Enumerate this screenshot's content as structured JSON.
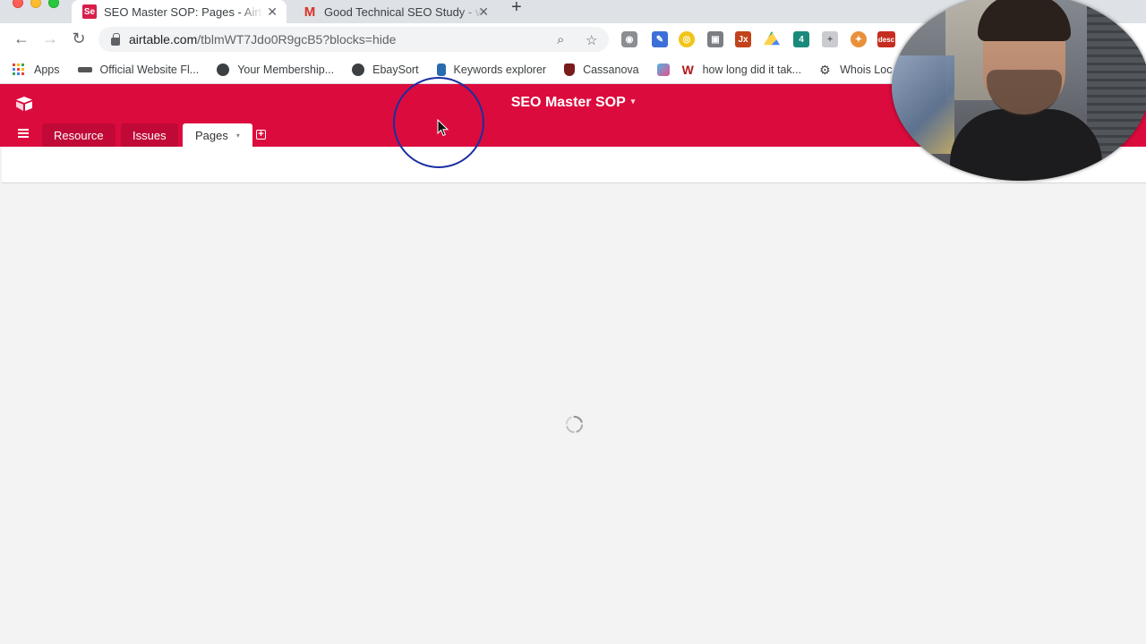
{
  "browser": {
    "tabs": [
      {
        "title": "SEO Master SOP: Pages - Airtable",
        "favicon": "Se",
        "active": true
      },
      {
        "title": "Good Technical SEO Study - vi",
        "favicon": "M",
        "active": false
      }
    ],
    "new_tab_icon": "+",
    "url_host": "airtable.com",
    "url_path": "/tblmWT7Jdo0R9gcB5?blocks=hide",
    "bookmarks": [
      {
        "label": "Apps",
        "icon": "apps-grid-icon"
      },
      {
        "label": "Official Website Fl...",
        "icon": "site-icon"
      },
      {
        "label": "Your Membership...",
        "icon": "globe-icon"
      },
      {
        "label": "EbaySort",
        "icon": "globe-icon"
      },
      {
        "label": "Keywords explorer",
        "icon": "hand-icon"
      },
      {
        "label": "Cassanova",
        "icon": "shield-icon"
      },
      {
        "label": "how long did it tak...",
        "icon": "w-icon"
      },
      {
        "label": "Whois Loc",
        "icon": "gear-icon"
      }
    ],
    "extension_badges": {
      "jx": "Jx",
      "count": "4",
      "desc": "desc"
    }
  },
  "airtable": {
    "base_name": "SEO Master SOP",
    "base_caret": "▾",
    "tables": [
      {
        "label": "Resource",
        "active": false
      },
      {
        "label": "Issues",
        "active": false
      },
      {
        "label": "Pages",
        "active": true
      }
    ],
    "active_caret": "▾",
    "add_table": "+",
    "header_color": "#dc0b3e"
  },
  "status": {
    "loading": true
  }
}
